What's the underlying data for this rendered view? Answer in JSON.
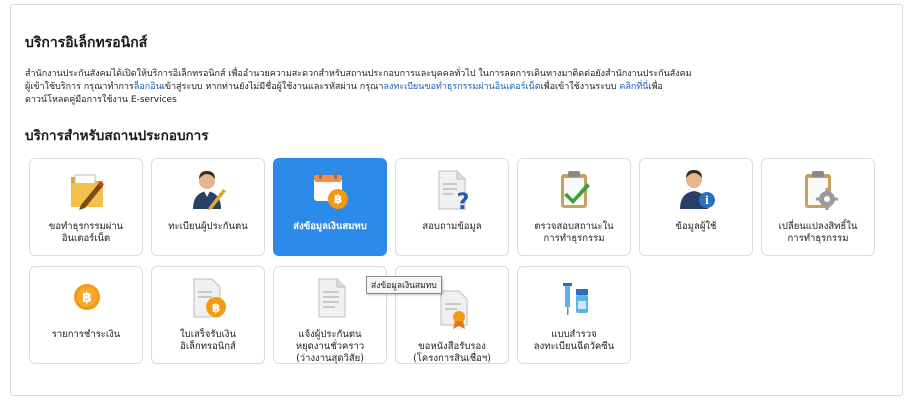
{
  "heading": "บริการอิเล็กทรอนิกส์",
  "intro": {
    "line1": "สำนักงานประกันสังคมได้เปิดให้บริการอิเล็กทรอนิกส์ เพื่ออำนวยความสะดวกสำหรับสถานประกอบการและบุคคลทั่วไป ในการลดการเดินทางมาติดต่อยังสำนักงานประกันสังคม",
    "line2_a": "ผู้เข้าใช้บริการ กรุณาทำการ",
    "login_link": "ล็อกอิน",
    "line2_b": "เข้าสู่ระบบ หากท่านยังไม่มีชื่อผู้ใช้งานและรหัสผ่าน กรุณา",
    "register_link": "ลงทะเบียนขอทำธุรกรรมผ่านอินเตอร์เน็ต",
    "line2_c": "เพื่อเข้าใช้งานระบบ ",
    "click_here_link": "คลิกที่นี่",
    "line2_d": "เพื่อ",
    "line3": "ดาวน์โหลดคู่มือการใช้งาน E-services"
  },
  "section_title": "บริการสำหรับสถานประกอบการ",
  "tiles": [
    {
      "label": "ขอทำธุรกรรมผ่าน\nอินเตอร์เน็ต",
      "icon": "folder-pen-icon"
    },
    {
      "label": "ทะเบียนผู้ประกันตน",
      "icon": "person-pen-icon"
    },
    {
      "label": "ส่งข้อมูลเงินสมทบ",
      "icon": "calendar-baht-icon"
    },
    {
      "label": "สอบถามข้อมูล",
      "icon": "document-question-icon"
    },
    {
      "label": "ตรวจสอบสถานะใน\nการทำธุรกรรม",
      "icon": "clipboard-check-icon"
    },
    {
      "label": "ข้อมูลผู้ใช้",
      "icon": "person-info-icon"
    },
    {
      "label": "เปลี่ยนแปลงสิทธิ์ใน\nการทำธุรกรรม",
      "icon": "clipboard-gear-icon"
    },
    {
      "label": "รายการชำระเงิน",
      "icon": "baht-coin-icon"
    },
    {
      "label": "ใบเสร็จรับเงิน\nอิเล็กทรอนิกส์",
      "icon": "receipt-baht-icon"
    },
    {
      "label": "แจ้งผู้ประกันตน\nหยุดงานชั่วคราว\n(ว่างงานสุดวิสัย)",
      "icon": "document-icon"
    },
    {
      "label": "ขอหนังสือรับรอง\n(โครงการสินเชื่อฯ)",
      "icon": "certificate-icon"
    },
    {
      "label": "แบบสำรวจ\nลงทะเบียนฉีดวัคซีน",
      "icon": "vaccine-icon"
    }
  ],
  "tooltip": "ส่งข้อมูลเงินสมทบ",
  "colors": {
    "accent": "#2c8ae8",
    "link": "#1a5fb4"
  }
}
